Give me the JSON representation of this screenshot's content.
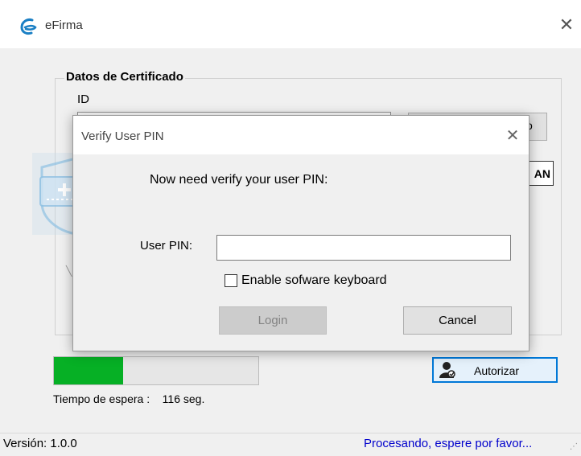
{
  "window": {
    "title": "eFirma",
    "close_glyph": "✕",
    "icons": {
      "app": "efirma-logo-icon",
      "close": "close-icon"
    }
  },
  "certificate_group": {
    "title": "Datos de Certificado",
    "id_label": "ID",
    "id_value": "",
    "partial_button_label": "o",
    "scan_button_label": "AN"
  },
  "dialog": {
    "title": "Verify User PIN",
    "close_glyph": "✕",
    "message": "Now need verify your user PIN:",
    "pin_label": "User PIN:",
    "pin_value": "",
    "keyboard_checkbox_label": "Enable sofware keyboard",
    "keyboard_checked": false,
    "login_label": "Login",
    "login_enabled": false,
    "cancel_label": "Cancel",
    "icons": {
      "users": "users-icon",
      "shield": "shield-graphic"
    }
  },
  "progress": {
    "value": 0.34,
    "fill_color": "#06b025",
    "wait_text": "Tiempo de espera :    116 seg."
  },
  "authorize_button": {
    "label": "Autorizar",
    "icon": "user-authorize-icon",
    "border_color": "#0078d7"
  },
  "statusbar": {
    "version": "Versión: 1.0.0",
    "status": "Procesando, espere por favor...",
    "status_color": "#0000cc"
  }
}
